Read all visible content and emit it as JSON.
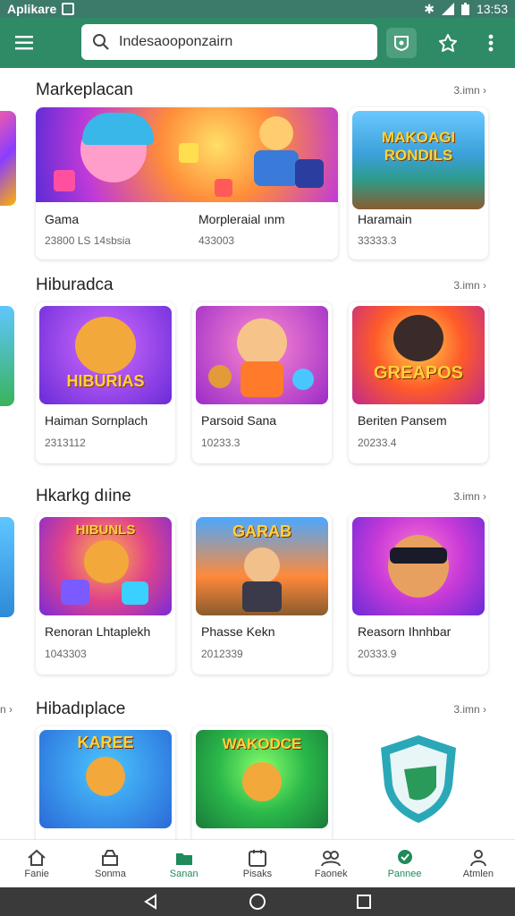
{
  "status": {
    "app_name": "Aplikare",
    "time": "13:53"
  },
  "search": {
    "value": "Indesaooponzairn"
  },
  "sections": [
    {
      "title": "Markeplacan",
      "more": "3.imn",
      "cards": [
        {
          "name": "Gama",
          "meta": "23800 LS  14sbsia"
        },
        {
          "name": "Morpleraial  ınm",
          "meta": "433003"
        },
        {
          "name": "Haramain",
          "meta": "33333.3"
        }
      ]
    },
    {
      "title": "Hiburadca",
      "more": "3.imn",
      "cards": [
        {
          "name": "Haiman Sornplach",
          "meta": "2313112"
        },
        {
          "name": "Parsoid Sana",
          "meta": "10233.3"
        },
        {
          "name": "Beriten Pansem",
          "meta": "20233.4"
        }
      ]
    },
    {
      "title": "Hkarkg dıine",
      "more": "3.imn",
      "cards": [
        {
          "name": "Renoran Lhtaplekh",
          "meta": "1043303"
        },
        {
          "name": "Phasse Kekn",
          "meta": "2012339"
        },
        {
          "name": "Reasorn Ihnhbar",
          "meta": "20333.9"
        }
      ]
    },
    {
      "title": "Hibadıplace",
      "more": "3.imn",
      "cards": [
        {
          "name": "",
          "meta": ""
        },
        {
          "name": "",
          "meta": ""
        },
        {
          "name": "",
          "meta": ""
        }
      ]
    }
  ],
  "thumb_texts": {
    "makodi": "MAKOAGI RONDILS",
    "hiburias": "HIBURIAS",
    "greapos": "GREAPOS",
    "hibunls": "HIBUNLS",
    "garab": "GARAB",
    "karee": "KAREE",
    "wakodce": "WAKODCE"
  },
  "left_peek_more": "n",
  "nav": [
    {
      "label": "Fanie",
      "icon": "home-icon"
    },
    {
      "label": "Sonma",
      "icon": "store-icon"
    },
    {
      "label": "Sanan",
      "icon": "folder-icon",
      "active": true
    },
    {
      "label": "Pisaks",
      "icon": "calendar-icon"
    },
    {
      "label": "Faonek",
      "icon": "people-icon"
    },
    {
      "label": "Pannee",
      "icon": "location-icon",
      "active": true
    },
    {
      "label": "Atmlen",
      "icon": "profile-icon"
    }
  ],
  "colors": {
    "appbar": "#2f8a66",
    "statusbar": "#3c7a6a",
    "accent": "#1f8a5a"
  }
}
